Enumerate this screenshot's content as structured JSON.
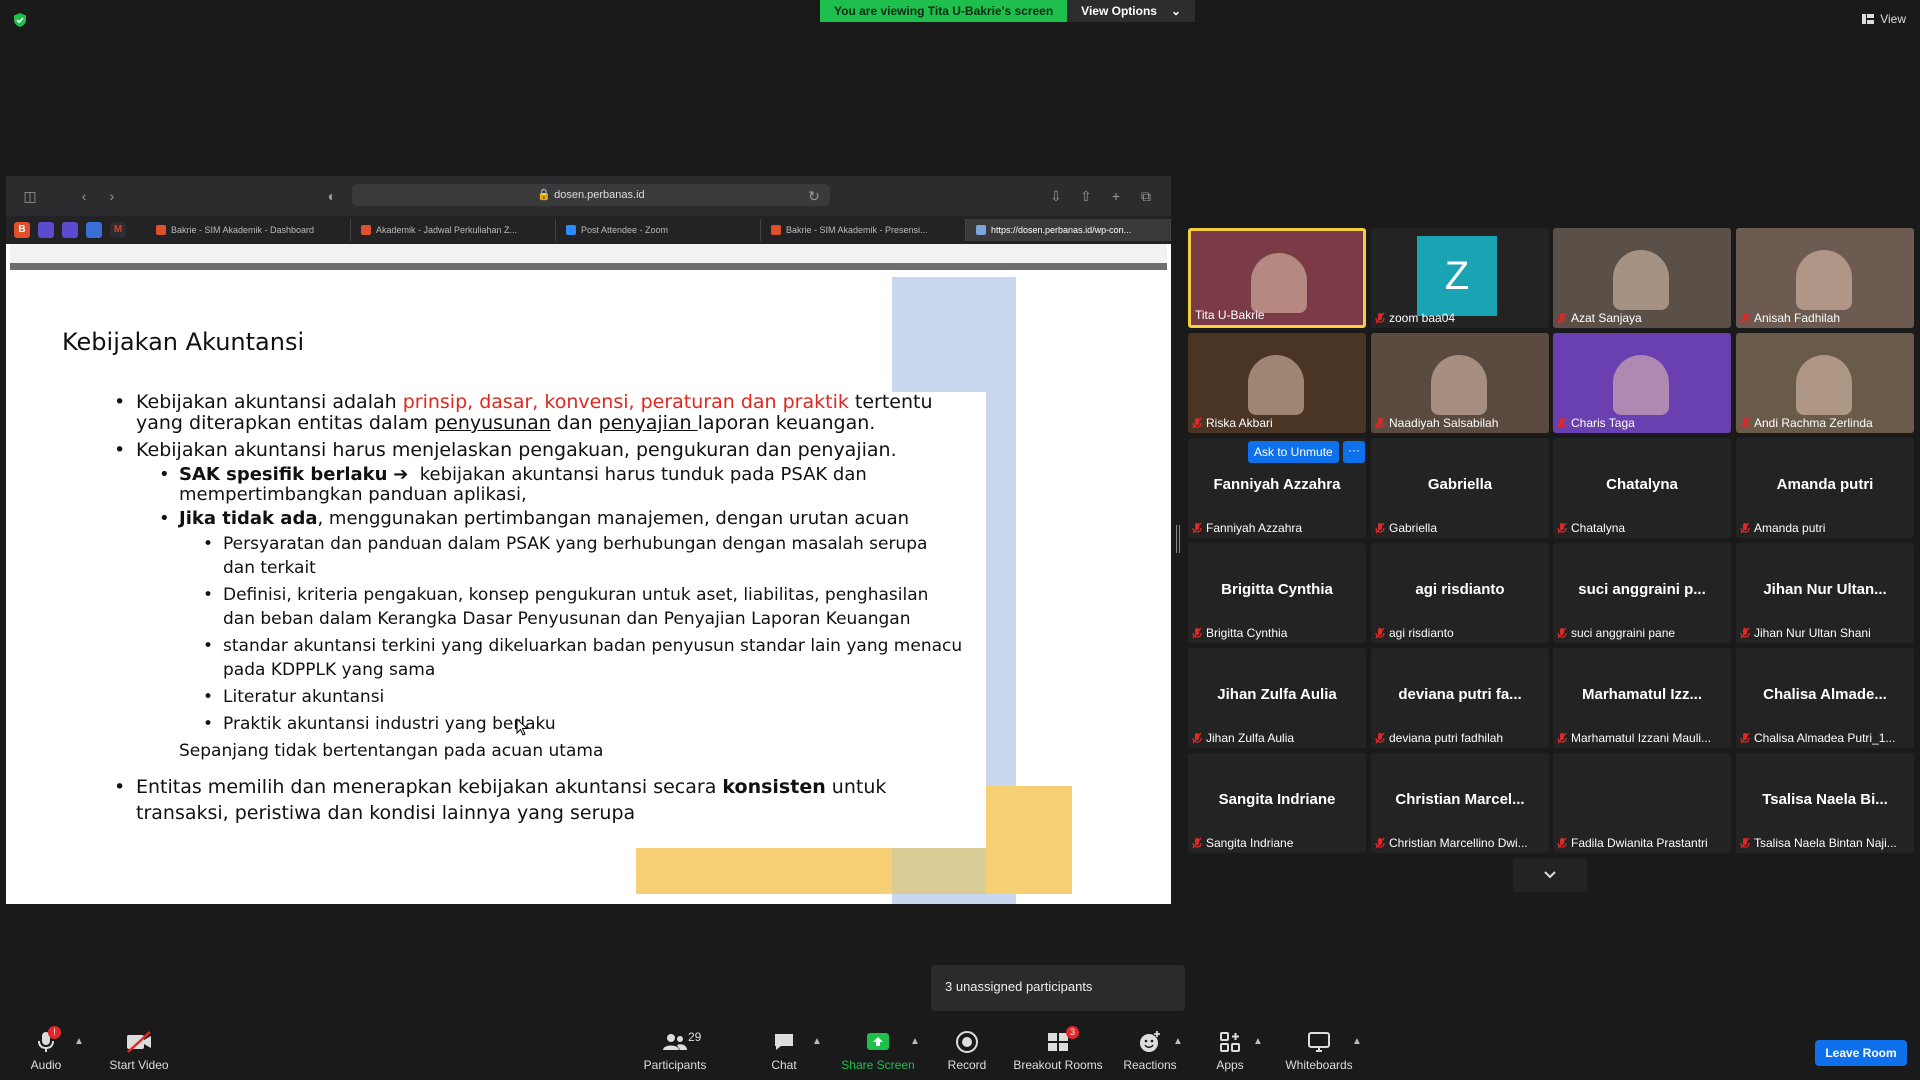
{
  "top": {
    "viewing_banner": "You are viewing Tita U-Bakrie's screen",
    "view_options": "View Options",
    "view": "View"
  },
  "browser": {
    "url": "dosen.perbanas.id",
    "tabs": [
      {
        "label": "Bakrie - SIM Akademik - Dashboard"
      },
      {
        "label": "Akademik - Jadwal Perkuliahan Z..."
      },
      {
        "label": "Post Attendee - Zoom"
      },
      {
        "label": "Bakrie - SIM Akademik - Presensi..."
      },
      {
        "label": "https://dosen.perbanas.id/wp-con..."
      }
    ]
  },
  "slide": {
    "title": "Kebijakan Akuntansi",
    "b1_a": "Kebijakan akuntansi adalah ",
    "b1_red": "prinsip, dasar, konvensi, peraturan dan praktik",
    "b1_b": " tertentu",
    "b1_line2_a": "yang diterapkan entitas dalam ",
    "b1_line2_u1": "penyusunan",
    "b1_line2_mid": " dan ",
    "b1_line2_u2": "penyajian ",
    "b1_line2_end": "laporan keuangan.",
    "b2": "Kebijakan akuntansi harus menjelaskan pengakuan, pengukuran dan penyajian.",
    "b2_1_bold": "SAK spesifik berlaku",
    "b2_1_arrow": "➔",
    "b2_1_rest": "kebijakan akuntansi harus tunduk pada PSAK dan",
    "b2_1_line2": "mempertimbangkan panduan aplikasi,",
    "b2_2_bold": "Jika tidak ada",
    "b2_2_rest": ", menggunakan pertimbangan manajemen, dengan urutan acuan",
    "sub1_l1": "Persyaratan dan panduan dalam PSAK yang berhubungan dengan masalah serupa",
    "sub1_l2": "dan terkait",
    "sub2_l1": "Definisi, kriteria pengakuan, konsep pengukuran untuk aset, liabilitas, penghasilan",
    "sub2_l2": "dan beban dalam Kerangka Dasar Penyusunan dan Penyajian Laporan Keuangan",
    "sub3_l1": "standar akuntansi terkini yang dikeluarkan badan penyusun standar lain yang menacu",
    "sub3_l2": "pada KDPPLK yang sama",
    "sub4": "Literatur akuntansi",
    "sub5": "Praktik akuntansi industri yang berlaku",
    "sepanjang": "Sepanjang tidak bertentangan pada acuan utama",
    "b3_a": "Entitas memilih dan menerapkan kebijakan akuntansi secara ",
    "b3_bold": "konsisten",
    "b3_b": " untuk",
    "b3_line2": "transaksi, peristiwa dan kondisi lainnya yang serupa"
  },
  "gallery": {
    "ask_unmute": "Ask to Unmute",
    "more": "···",
    "video_tiles": [
      {
        "name": "Tita U-Bakrie",
        "muted": false
      },
      {
        "name": "zoom baa04",
        "avatar": "Z",
        "muted": true
      },
      {
        "name": "Azat Sanjaya",
        "muted": true
      },
      {
        "name": "Anisah Fadhilah",
        "muted": true
      },
      {
        "name": "Riska Akbari",
        "muted": true
      },
      {
        "name": "Naadiyah Salsabilah",
        "muted": true
      },
      {
        "name": "Charis Taga",
        "muted": true
      },
      {
        "name": "Andi Rachma Zerlinda",
        "muted": true
      }
    ],
    "name_tiles": [
      {
        "big": "Fanniyah Azzahra",
        "name": "Fanniyah Azzahra"
      },
      {
        "big": "Gabriella",
        "name": "Gabriella"
      },
      {
        "big": "Chatalyna",
        "name": "Chatalyna"
      },
      {
        "big": "Amanda putri",
        "name": "Amanda putri"
      },
      {
        "big": "Brigitta Cynthia",
        "name": "Brigitta Cynthia"
      },
      {
        "big": "agi risdianto",
        "name": "agi risdianto"
      },
      {
        "big": "suci anggraini p...",
        "name": "suci anggraini pane"
      },
      {
        "big": "Jihan Nur Ultan...",
        "name": "Jihan Nur Ultan Shani"
      },
      {
        "big": "Jihan Zulfa Aulia",
        "name": "Jihan Zulfa Aulia"
      },
      {
        "big": "deviana putri fa...",
        "name": "deviana putri fadhilah"
      },
      {
        "big": "Marhamatul Izz...",
        "name": "Marhamatul Izzani Mauli..."
      },
      {
        "big": "Chalisa Almade...",
        "name": "Chalisa Almadea Putri_1..."
      },
      {
        "big": "Sangita Indriane",
        "name": "Sangita Indriane"
      },
      {
        "big": "Christian Marcel...",
        "name": "Christian Marcellino Dwi..."
      },
      {
        "big": "",
        "name": "Fadila Dwianita Prastantri"
      },
      {
        "big": "Tsalisa Naela Bi...",
        "name": "Tsalisa Naela Bintan Naji..."
      }
    ]
  },
  "unassigned": "3 unassigned participants",
  "toolbar": {
    "audio": "Audio",
    "audio_badge": "!",
    "start_video": "Start Video",
    "participants": "Participants",
    "participants_count": "29",
    "chat": "Chat",
    "share_screen": "Share Screen",
    "record": "Record",
    "breakout_rooms": "Breakout Rooms",
    "breakout_badge": "3",
    "reactions": "Reactions",
    "apps": "Apps",
    "whiteboards": "Whiteboards",
    "leave_room": "Leave Room"
  },
  "colors": {
    "accent_blue": "#0e71eb",
    "share_green": "#1fbf4d",
    "muted_red": "#e02828",
    "active_speaker": "#f4d03f"
  }
}
